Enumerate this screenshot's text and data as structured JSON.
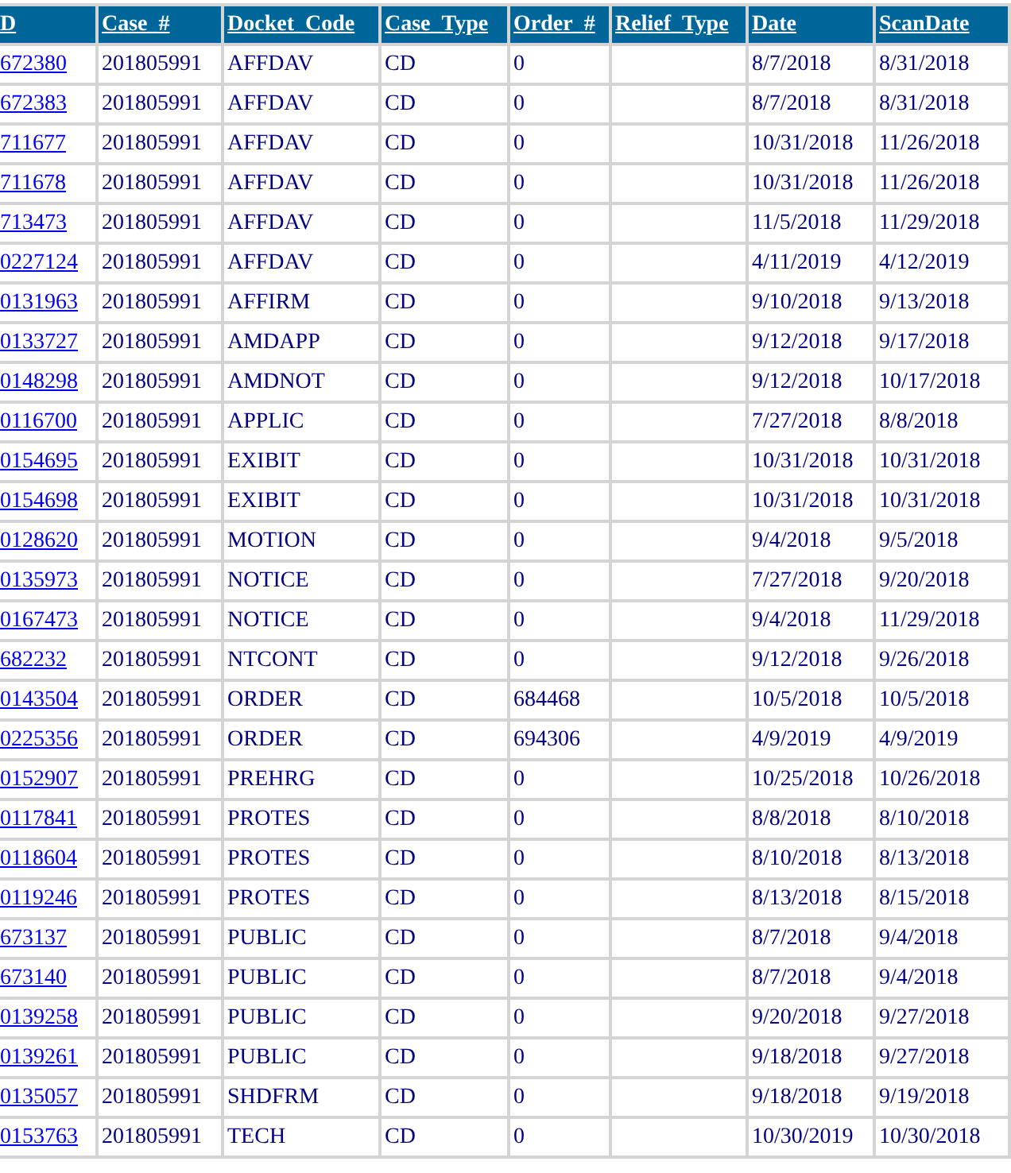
{
  "table": {
    "columns": [
      "D",
      "Case_#",
      "Docket_Code",
      "Case_Type",
      "Order_#",
      "Relief_Type",
      "Date",
      "ScanDate"
    ],
    "rows": [
      {
        "id": "672380",
        "case_no": "201805991",
        "docket_code": "AFFDAV",
        "case_type": "CD",
        "order_no": "0",
        "date": "8/7/2018",
        "scan_date": "8/31/2018"
      },
      {
        "id": "672383",
        "case_no": "201805991",
        "docket_code": "AFFDAV",
        "case_type": "CD",
        "order_no": "0",
        "date": "8/7/2018",
        "scan_date": "8/31/2018"
      },
      {
        "id": "711677",
        "case_no": "201805991",
        "docket_code": "AFFDAV",
        "case_type": "CD",
        "order_no": "0",
        "date": "10/31/2018",
        "scan_date": "11/26/2018"
      },
      {
        "id": "711678",
        "case_no": "201805991",
        "docket_code": "AFFDAV",
        "case_type": "CD",
        "order_no": "0",
        "date": "10/31/2018",
        "scan_date": "11/26/2018"
      },
      {
        "id": "713473",
        "case_no": "201805991",
        "docket_code": "AFFDAV",
        "case_type": "CD",
        "order_no": "0",
        "date": "11/5/2018",
        "scan_date": "11/29/2018"
      },
      {
        "id": "0227124",
        "case_no": "201805991",
        "docket_code": "AFFDAV",
        "case_type": "CD",
        "order_no": "0",
        "date": "4/11/2019",
        "scan_date": "4/12/2019"
      },
      {
        "id": "0131963",
        "case_no": "201805991",
        "docket_code": "AFFIRM",
        "case_type": "CD",
        "order_no": "0",
        "date": "9/10/2018",
        "scan_date": "9/13/2018"
      },
      {
        "id": "0133727",
        "case_no": "201805991",
        "docket_code": "AMDAPP",
        "case_type": "CD",
        "order_no": "0",
        "date": "9/12/2018",
        "scan_date": "9/17/2018"
      },
      {
        "id": "0148298",
        "case_no": "201805991",
        "docket_code": "AMDNOT",
        "case_type": "CD",
        "order_no": "0",
        "date": "9/12/2018",
        "scan_date": "10/17/2018"
      },
      {
        "id": "0116700",
        "case_no": "201805991",
        "docket_code": "APPLIC",
        "case_type": "CD",
        "order_no": "0",
        "date": "7/27/2018",
        "scan_date": "8/8/2018"
      },
      {
        "id": "0154695",
        "case_no": "201805991",
        "docket_code": "EXIBIT",
        "case_type": "CD",
        "order_no": "0",
        "date": "10/31/2018",
        "scan_date": "10/31/2018"
      },
      {
        "id": "0154698",
        "case_no": "201805991",
        "docket_code": "EXIBIT",
        "case_type": "CD",
        "order_no": "0",
        "date": "10/31/2018",
        "scan_date": "10/31/2018"
      },
      {
        "id": "0128620",
        "case_no": "201805991",
        "docket_code": "MOTION",
        "case_type": "CD",
        "order_no": "0",
        "date": "9/4/2018",
        "scan_date": "9/5/2018"
      },
      {
        "id": "0135973",
        "case_no": "201805991",
        "docket_code": "NOTICE",
        "case_type": "CD",
        "order_no": "0",
        "date": "7/27/2018",
        "scan_date": "9/20/2018"
      },
      {
        "id": "0167473",
        "case_no": "201805991",
        "docket_code": "NOTICE",
        "case_type": "CD",
        "order_no": "0",
        "date": "9/4/2018",
        "scan_date": "11/29/2018"
      },
      {
        "id": "682232",
        "case_no": "201805991",
        "docket_code": "NTCONT",
        "case_type": "CD",
        "order_no": "0",
        "date": "9/12/2018",
        "scan_date": "9/26/2018"
      },
      {
        "id": "0143504",
        "case_no": "201805991",
        "docket_code": "ORDER",
        "case_type": "CD",
        "order_no": "684468",
        "date": "10/5/2018",
        "scan_date": "10/5/2018"
      },
      {
        "id": "0225356",
        "case_no": "201805991",
        "docket_code": "ORDER",
        "case_type": "CD",
        "order_no": "694306",
        "date": "4/9/2019",
        "scan_date": "4/9/2019"
      },
      {
        "id": "0152907",
        "case_no": "201805991",
        "docket_code": "PREHRG",
        "case_type": "CD",
        "order_no": "0",
        "date": "10/25/2018",
        "scan_date": "10/26/2018"
      },
      {
        "id": "0117841",
        "case_no": "201805991",
        "docket_code": "PROTES",
        "case_type": "CD",
        "order_no": "0",
        "date": "8/8/2018",
        "scan_date": "8/10/2018"
      },
      {
        "id": "0118604",
        "case_no": "201805991",
        "docket_code": "PROTES",
        "case_type": "CD",
        "order_no": "0",
        "date": "8/10/2018",
        "scan_date": "8/13/2018"
      },
      {
        "id": "0119246",
        "case_no": "201805991",
        "docket_code": "PROTES",
        "case_type": "CD",
        "order_no": "0",
        "date": "8/13/2018",
        "scan_date": "8/15/2018"
      },
      {
        "id": "673137",
        "case_no": "201805991",
        "docket_code": "PUBLIC",
        "case_type": "CD",
        "order_no": "0",
        "date": "8/7/2018",
        "scan_date": "9/4/2018"
      },
      {
        "id": "673140",
        "case_no": "201805991",
        "docket_code": "PUBLIC",
        "case_type": "CD",
        "order_no": "0",
        "date": "8/7/2018",
        "scan_date": "9/4/2018"
      },
      {
        "id": "0139258",
        "case_no": "201805991",
        "docket_code": "PUBLIC",
        "case_type": "CD",
        "order_no": "0",
        "date": "9/20/2018",
        "scan_date": "9/27/2018"
      },
      {
        "id": "0139261",
        "case_no": "201805991",
        "docket_code": "PUBLIC",
        "case_type": "CD",
        "order_no": "0",
        "date": "9/18/2018",
        "scan_date": "9/27/2018"
      },
      {
        "id": "0135057",
        "case_no": "201805991",
        "docket_code": "SHDFRM",
        "case_type": "CD",
        "order_no": "0",
        "date": "9/18/2018",
        "scan_date": "9/19/2018"
      },
      {
        "id": "0153763",
        "case_no": "201805991",
        "docket_code": "TECH",
        "case_type": "CD",
        "order_no": "0",
        "date": "10/30/2019",
        "scan_date": "10/30/2018"
      }
    ]
  }
}
